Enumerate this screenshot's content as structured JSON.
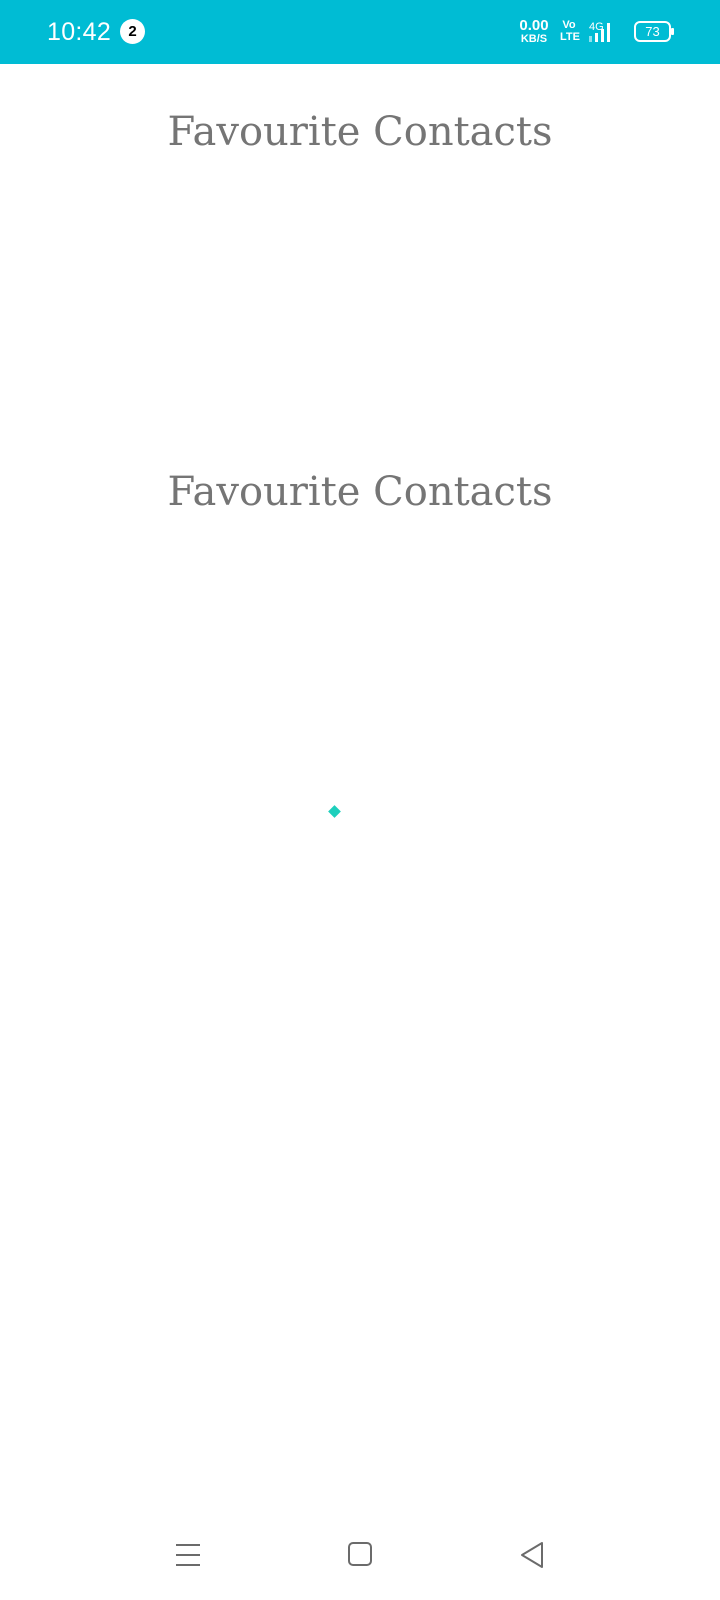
{
  "status_bar": {
    "time": "10:42",
    "notification_count": "2",
    "network_speed_value": "0.00",
    "network_speed_unit": "KB/S",
    "volte_top": "Vo",
    "volte_bottom": "LTE",
    "network_type": "4G",
    "battery_level": "73",
    "background_color": "#00BCD4"
  },
  "main": {
    "heading_primary": "Favourite Contacts",
    "heading_secondary": "Favourite Contacts",
    "loader_color": "#1DCFBC"
  },
  "nav_bar": {
    "menu_icon": "menu-icon",
    "home_icon": "home-square-icon",
    "back_icon": "back-triangle-icon"
  }
}
